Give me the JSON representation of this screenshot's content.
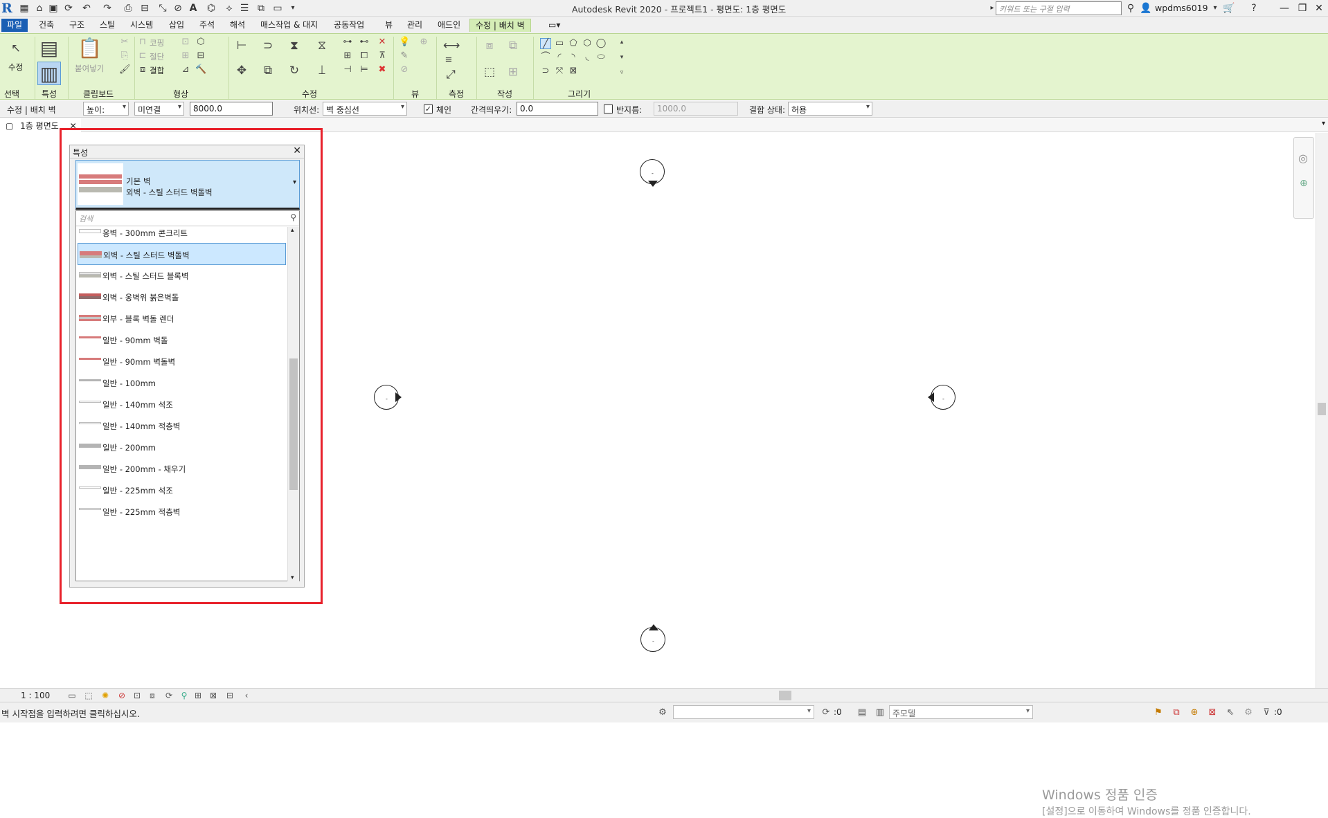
{
  "title_bar": {
    "app_logo": "R",
    "window_title": "Autodesk Revit 2020 - 프로젝트1 - 평면도: 1층 평면도",
    "search_placeholder": "키워드 또는 구절 입력",
    "user_name": "wpdms6019"
  },
  "ribbon_tabs": [
    "파일",
    "건축",
    "구조",
    "스틸",
    "시스템",
    "삽입",
    "주석",
    "해석",
    "매스작업 & 대지",
    "공동작업",
    "뷰",
    "관리",
    "애드인",
    "수정 | 배치 벽"
  ],
  "active_tab": "수정 | 배치 벽",
  "ribbon": {
    "modify_label": "수정",
    "paste_label": "붙여넣기",
    "cope_label": "코핑",
    "cut_label": "절단",
    "join_label": "결합",
    "panels": {
      "select": "선택",
      "properties": "특성",
      "clipboard": "클립보드",
      "geometry": "형상",
      "modify": "수정",
      "view": "뷰",
      "measure": "측정",
      "create": "작성",
      "draw": "그리기"
    }
  },
  "options_bar": {
    "context": "수정 | 배치 벽",
    "height_mode": "높이:",
    "constraint": "미연결",
    "height_value": "8000.0",
    "location_line_label": "위치선:",
    "location_line_value": "벽 중심선",
    "chain_label": "체인",
    "chain_checked": true,
    "offset_label": "간격띄우기:",
    "offset_value": "0.0",
    "radius_label": "반지름:",
    "radius_checked": false,
    "radius_value": "1000.0",
    "join_status_label": "결합 상태:",
    "join_status_value": "허용"
  },
  "view_tab": {
    "label": "1층 평면도"
  },
  "properties": {
    "title": "특성",
    "family": "기본 벽",
    "type": "외벽 - 스틸 스터드 벽돌벽",
    "search_placeholder": "검색",
    "items": [
      {
        "label": "옹벽 - 300mm 콘크리트",
        "swatch": "plain"
      },
      {
        "label": "외벽 - 스틸 스터드 벽돌벽",
        "swatch": "brick-gray",
        "selected": true
      },
      {
        "label": "외벽 - 스틸 스터드 블록벽",
        "swatch": "gray-block"
      },
      {
        "label": "외벽 - 옹벽위 붉은벽돌",
        "swatch": "brick-dark"
      },
      {
        "label": "외부 - 블록 벽돌 렌더",
        "swatch": "brick-block"
      },
      {
        "label": "일반 - 90mm 벽돌",
        "swatch": "red-line"
      },
      {
        "label": "일반 - 90mm 벽돌벽",
        "swatch": "red-line"
      },
      {
        "label": "일반 - 100mm",
        "swatch": "gray-line"
      },
      {
        "label": "일반 - 140mm 석조",
        "swatch": "thin"
      },
      {
        "label": "일반 - 140mm 적층벽",
        "swatch": "thin"
      },
      {
        "label": "일반 - 200mm",
        "swatch": "gray-thick"
      },
      {
        "label": "일반 - 200mm - 채우기",
        "swatch": "gray-thick"
      },
      {
        "label": "일반 - 225mm 석조",
        "swatch": "thin"
      },
      {
        "label": "일반 - 225mm 적층벽",
        "swatch": "thin"
      }
    ]
  },
  "canvas": {
    "marker_dot": "-"
  },
  "watermark": {
    "title": "Windows 정품 인증",
    "subtitle": "[설정]으로 이동하여 Windows를 정품 인증합니다."
  },
  "view_control": {
    "scale": "1 : 100"
  },
  "status_bar": {
    "message": "벽 시작점을 입력하려면 클릭하십시오.",
    "selection_count": ":0",
    "model_label": "주모델",
    "filter_count": ":0"
  },
  "colors": {
    "ribbon_bg": "#e4f4cf",
    "file_tab": "#1a5fb4",
    "selection_blue": "#cce8ff",
    "highlight_red": "#e8212b",
    "brick_red": "#d77b7b"
  }
}
